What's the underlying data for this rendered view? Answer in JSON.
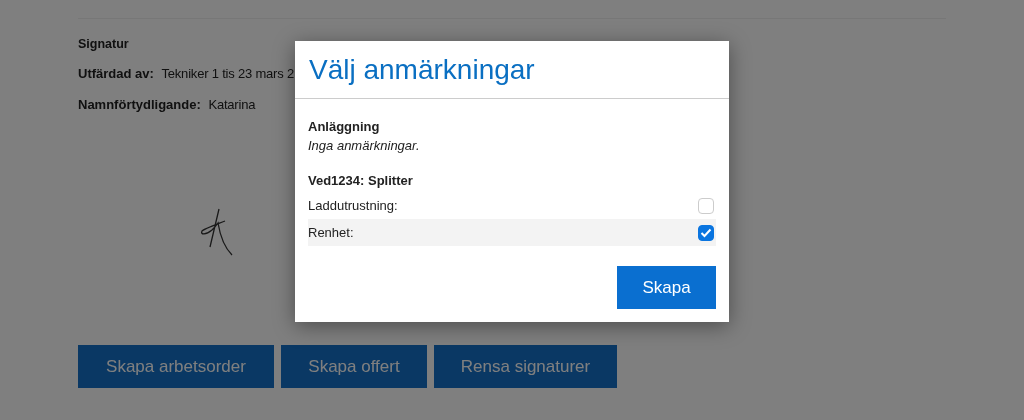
{
  "page": {
    "heading": "Signatur",
    "fields": [
      {
        "label": "Utfärdad av:",
        "value": "Tekniker 1 tis 23 mars 2"
      },
      {
        "label": "Namnförtydligande:",
        "value": "Katarina"
      }
    ],
    "buttons": [
      "Skapa arbetsorder",
      "Skapa offert",
      "Rensa signaturer"
    ]
  },
  "dialog": {
    "title": "Välj anmärkningar",
    "sections": [
      {
        "heading": "Anläggning",
        "empty_text": "Inga anmärkningar."
      },
      {
        "heading": "Ved1234: Splitter",
        "items": [
          {
            "label": "Laddutrustning:",
            "checked": false
          },
          {
            "label": "Renhet:",
            "checked": true
          }
        ]
      }
    ],
    "button": "Skapa"
  }
}
